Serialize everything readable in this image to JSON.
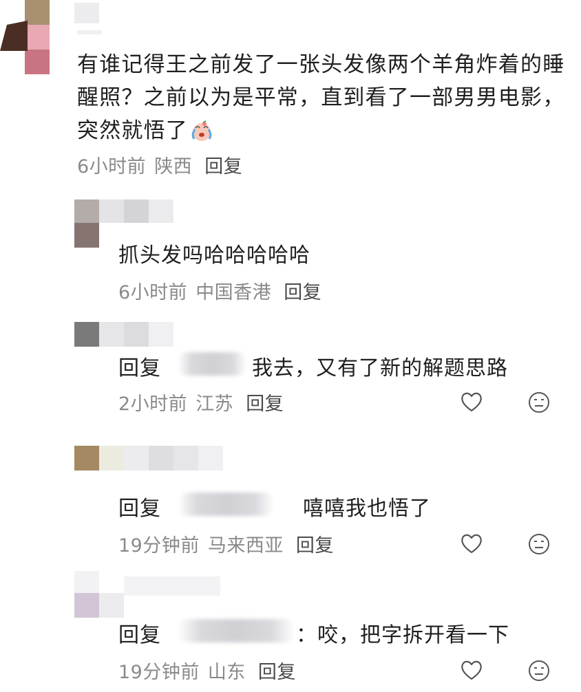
{
  "comment": {
    "text": "有谁记得王之前发了一张头发像两个羊角炸着的睡醒照？之前以为是平常，直到看了一部男男电影，突然就悟了",
    "emoji": "crying-face-emoji",
    "time": "6小时前",
    "region": "陕西",
    "reply_label": "回复"
  },
  "replies": [
    {
      "text": "抓头发吗哈哈哈哈哈",
      "time": "6小时前",
      "region": "中国香港",
      "reply_label": "回复"
    },
    {
      "prefix": "回复",
      "text": "我去，又有了新的解题思路",
      "time": "2小时前",
      "region": "江苏",
      "reply_label": "回复"
    },
    {
      "prefix": "回复",
      "text": "嘻嘻我也悟了",
      "time": "19分钟前",
      "region": "马来西亚",
      "reply_label": "回复"
    },
    {
      "prefix": "回复",
      "text": "：咬，把字拆开看一下",
      "time": "19分钟前",
      "region": "山东",
      "reply_label": "回复"
    }
  ],
  "icons": {
    "like": "heart-outline-icon",
    "emoji_react": "neutral-face-icon"
  },
  "colors": {
    "text": "#1f1f1f",
    "meta": "#8a8a8a",
    "icon": "#555555"
  }
}
